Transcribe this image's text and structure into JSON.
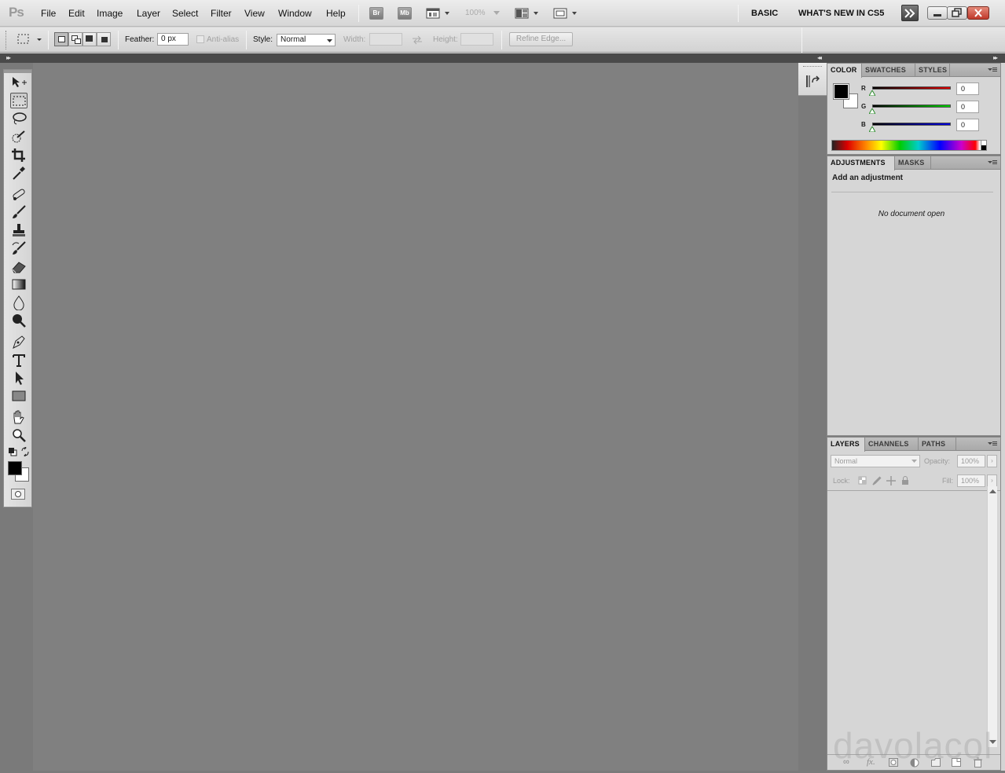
{
  "app": {
    "logo": "Ps"
  },
  "menubar": {
    "items": [
      "File",
      "Edit",
      "Image",
      "Layer",
      "Select",
      "Filter",
      "View",
      "Window",
      "Help"
    ],
    "bridge_label": "Br",
    "minibridge_label": "Mb",
    "zoom": "100%",
    "workspaces": [
      "BASIC",
      "WHAT'S NEW IN CS5"
    ]
  },
  "options_bar": {
    "feather_label": "Feather:",
    "feather_value": "0 px",
    "antialias_label": "Anti-alias",
    "style_label": "Style:",
    "style_value": "Normal",
    "width_label": "Width:",
    "height_label": "Height:",
    "refine_edge_label": "Refine Edge..."
  },
  "tools": [
    "move-tool-icon",
    "rectangular-marquee-tool-icon",
    "lasso-tool-icon",
    "quick-selection-tool-icon",
    "crop-tool-icon",
    "eyedropper-tool-icon",
    "spot-healing-brush-icon",
    "brush-tool-icon",
    "clone-stamp-icon",
    "history-brush-icon",
    "eraser-tool-icon",
    "gradient-tool-icon",
    "blur-tool-icon",
    "dodge-tool-icon",
    "pen-tool-icon",
    "type-tool-icon",
    "path-selection-icon",
    "rectangle-tool-icon",
    "hand-tool-icon",
    "zoom-tool-icon"
  ],
  "color_panel": {
    "tabs": [
      "COLOR",
      "SWATCHES",
      "STYLES"
    ],
    "r_label": "R",
    "g_label": "G",
    "b_label": "B",
    "r": "0",
    "g": "0",
    "b": "0",
    "foreground": "#000000",
    "background": "#ffffff"
  },
  "adjustments_panel": {
    "tabs": [
      "ADJUSTMENTS",
      "MASKS"
    ],
    "heading": "Add an adjustment",
    "message": "No document open"
  },
  "layers_panel": {
    "tabs": [
      "LAYERS",
      "CHANNELS",
      "PATHS"
    ],
    "blend_mode": "Normal",
    "opacity_label": "Opacity:",
    "opacity": "100%",
    "lock_label": "Lock:",
    "fill_label": "Fill:",
    "fill": "100%"
  },
  "watermark": "davolacol"
}
